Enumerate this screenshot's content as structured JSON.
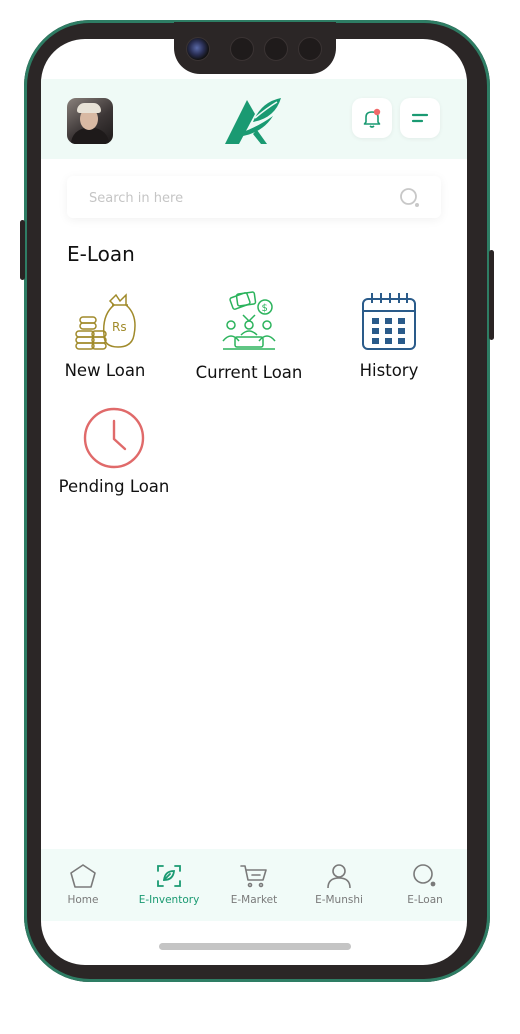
{
  "header": {
    "avatar": "user-avatar",
    "logo": "leaf-logo",
    "notification_badge_color": "#f06a6a",
    "accent": "#1a9a72"
  },
  "search": {
    "placeholder": "Search in here",
    "value": ""
  },
  "section": {
    "title": "E-Loan"
  },
  "tiles": [
    {
      "label": "New Loan",
      "icon": "money-bag-coins-icon",
      "color": "#a08a2a"
    },
    {
      "label": "Current Loan",
      "icon": "team-money-icon",
      "color": "#2bb35c"
    },
    {
      "label": "History",
      "icon": "calendar-icon",
      "color": "#2a5b8a"
    },
    {
      "label": "Pending Loan",
      "icon": "clock-icon",
      "color": "#e06a6a"
    }
  ],
  "tabbar": {
    "active": "E-Inventory",
    "items": [
      {
        "label": "Home",
        "icon": "home-icon"
      },
      {
        "label": "E-Inventory",
        "icon": "scan-leaf-icon"
      },
      {
        "label": "E-Market",
        "icon": "cart-icon"
      },
      {
        "label": "E-Munshi",
        "icon": "user-icon"
      },
      {
        "label": "E-Loan",
        "icon": "search-icon"
      }
    ]
  }
}
